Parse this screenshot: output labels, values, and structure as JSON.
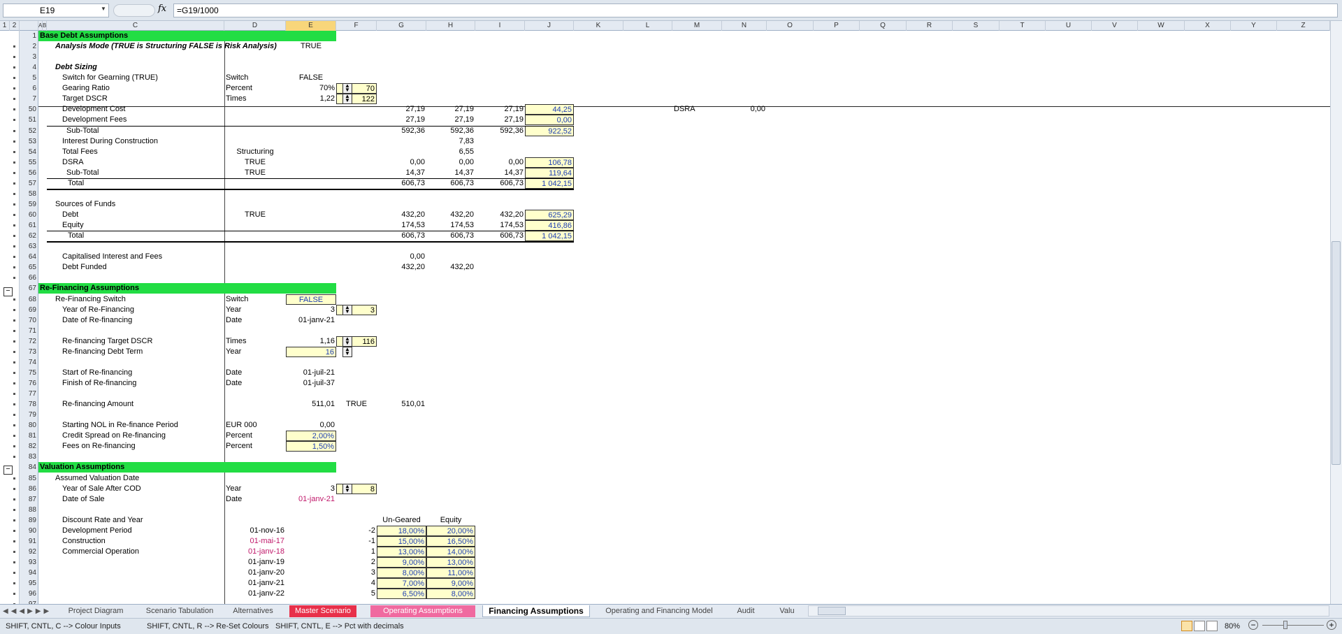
{
  "formula_bar": {
    "name_box": "E19",
    "fx_label": "fx",
    "formula": "=G19/1000"
  },
  "columns": [
    "A",
    "B",
    "C",
    "D",
    "E",
    "F",
    "G",
    "H",
    "I",
    "J",
    "K",
    "L",
    "M",
    "N",
    "O",
    "P",
    "Q",
    "R",
    "S",
    "T",
    "U",
    "V",
    "W",
    "X",
    "Y",
    "Z"
  ],
  "outline_levels": [
    "1",
    "2"
  ],
  "row_numbers": [
    "1",
    "2",
    "3",
    "4",
    "5",
    "6",
    "7",
    "50",
    "51",
    "52",
    "53",
    "54",
    "55",
    "56",
    "57",
    "58",
    "59",
    "60",
    "61",
    "62",
    "63",
    "64",
    "65",
    "66",
    "67",
    "68",
    "69",
    "70",
    "71",
    "72",
    "73",
    "74",
    "75",
    "76",
    "77",
    "78",
    "79",
    "80",
    "81",
    "82",
    "83",
    "84",
    "85",
    "86",
    "87",
    "88",
    "89",
    "90",
    "91",
    "92",
    "93",
    "94",
    "95",
    "96",
    "97"
  ],
  "cells": {
    "r1": {
      "c": "Base Debt Assumptions"
    },
    "r2": {
      "c": "Analysis Mode (TRUE is Structuring FALSE is Risk Analysis)",
      "e": "TRUE"
    },
    "r4": {
      "c": "Debt Sizing"
    },
    "r5": {
      "c": "Switch for Gearning (TRUE)",
      "d": "Switch",
      "e": "FALSE"
    },
    "r6": {
      "c": "Gearing Ratio",
      "d": "Percent",
      "e": "70%",
      "f": "70"
    },
    "r7": {
      "c": "Target DSCR",
      "d": "Times",
      "e": "1,22",
      "f": "122"
    },
    "r50": {
      "c": "Development Cost",
      "g": "27,19",
      "h": "27,19",
      "i": "27,19",
      "j": "44,25",
      "m": "DSRA",
      "n": "0,00"
    },
    "r51": {
      "c": "Development Fees",
      "g": "27,19",
      "h": "27,19",
      "i": "27,19",
      "j": "0,00"
    },
    "r52": {
      "c": "Sub-Total",
      "g": "592,36",
      "h": "592,36",
      "i": "592,36",
      "j": "922,52"
    },
    "r53": {
      "c": "Interest During Construction",
      "h": "7,83"
    },
    "r54": {
      "c": "Total Fees",
      "d": "Structuring",
      "h": "6,55"
    },
    "r55": {
      "c": "DSRA",
      "d": "TRUE",
      "g": "0,00",
      "h": "0,00",
      "i": "0,00",
      "j": "106,78"
    },
    "r56": {
      "c": "Sub-Total",
      "d": "TRUE",
      "g": "14,37",
      "h": "14,37",
      "i": "14,37",
      "j": "119,64"
    },
    "r57": {
      "c": "Total",
      "g": "606,73",
      "h": "606,73",
      "i": "606,73",
      "j": "1 042,15"
    },
    "r59": {
      "c": "Sources of Funds"
    },
    "r60": {
      "c": "Debt",
      "d": "TRUE",
      "g": "432,20",
      "h": "432,20",
      "i": "432,20",
      "j": "625,29"
    },
    "r61": {
      "c": "Equity",
      "g": "174,53",
      "h": "174,53",
      "i": "174,53",
      "j": "416,86"
    },
    "r62": {
      "c": "Total",
      "g": "606,73",
      "h": "606,73",
      "i": "606,73",
      "j": "1 042,15"
    },
    "r64": {
      "c": "Capitalised Interest and Fees",
      "g": "0,00"
    },
    "r65": {
      "c": "Debt Funded",
      "g": "432,20",
      "h": "432,20"
    },
    "r67": {
      "c": "Re-Financing Assumptions"
    },
    "r68": {
      "c": "Re-Financing Switch",
      "d": "Switch",
      "e": "FALSE"
    },
    "r69": {
      "c": "Year of Re-Financing",
      "d": "Year",
      "e": "3",
      "f": "3"
    },
    "r70": {
      "c": "Date of Re-financing",
      "d": "Date",
      "e": "01-janv-21"
    },
    "r72": {
      "c": "Re-financing Target DSCR",
      "d": "Times",
      "e": "1,16",
      "f": "116"
    },
    "r73": {
      "c": "Re-financing Debt Term",
      "d": "Year",
      "e": "16"
    },
    "r75": {
      "c": "Start of Re-financing",
      "d": "Date",
      "e": "01-juil-21"
    },
    "r76": {
      "c": "Finish of Re-financing",
      "d": "Date",
      "e": "01-juil-37"
    },
    "r78": {
      "c": "Re-financing Amount",
      "e": "511,01",
      "f": "TRUE",
      "g": "510,01"
    },
    "r80": {
      "c": "Starting NOL in Re-finance Period",
      "d": "EUR 000",
      "e": "0,00"
    },
    "r81": {
      "c": "Credit Spread on Re-financing",
      "d": "Percent",
      "e": "2,00%"
    },
    "r82": {
      "c": "Fees on Re-financing",
      "d": "Percent",
      "e": "1,50%"
    },
    "r84": {
      "c": "Valuation Assumptions"
    },
    "r85": {
      "c": "Assumed Valuation Date"
    },
    "r86": {
      "c": "Year of Sale After COD",
      "d": "Year",
      "e": "3",
      "f": "8"
    },
    "r87": {
      "c": "Date of Sale",
      "d": "Date",
      "e": "01-janv-21"
    },
    "r89": {
      "c": "Discount Rate and Year",
      "g": "Un-Geared",
      "h": "Equity"
    },
    "r90": {
      "c": "Development Period",
      "d": "01-nov-16",
      "f": "-2",
      "g": "18,00%",
      "h": "20,00%"
    },
    "r91": {
      "c": "Construction",
      "d": "01-mai-17",
      "f": "-1",
      "g": "15,00%",
      "h": "16,50%"
    },
    "r92": {
      "c": "Commercial Operation",
      "d": "01-janv-18",
      "f": "1",
      "g": "13,00%",
      "h": "14,00%"
    },
    "r93": {
      "d": "01-janv-19",
      "f": "2",
      "g": "9,00%",
      "h": "13,00%"
    },
    "r94": {
      "d": "01-janv-20",
      "f": "3",
      "g": "8,00%",
      "h": "11,00%"
    },
    "r95": {
      "d": "01-janv-21",
      "f": "4",
      "g": "7,00%",
      "h": "9,00%"
    },
    "r96": {
      "d": "01-janv-22",
      "f": "5",
      "g": "6,50%",
      "h": "8,00%"
    }
  },
  "sheet_tabs": [
    "Project Diagram",
    "Scenario Tabulation",
    "Alternatives",
    "Master Scenario",
    "Operating Assumptions",
    "Financing Assumptions",
    "Operating and Financing Model",
    "Audit",
    "Valu"
  ],
  "active_tab": "Financing Assumptions",
  "status": {
    "hint1": "SHIFT, CNTL, C --> Colour Inputs",
    "hint2": "SHIFT, CNTL, R --> Re-Set Colours",
    "hint3": "SHIFT, CNTL, E --> Pct with decimals",
    "zoom": "80%"
  },
  "colors": {
    "section_green": "#22dd44",
    "input_yellow": "#ffffcc",
    "input_blue": "#1f3fb3",
    "date_magenta": "#c0186a",
    "tab_red": "#e8304a",
    "tab_pink": "#f06aa0"
  }
}
